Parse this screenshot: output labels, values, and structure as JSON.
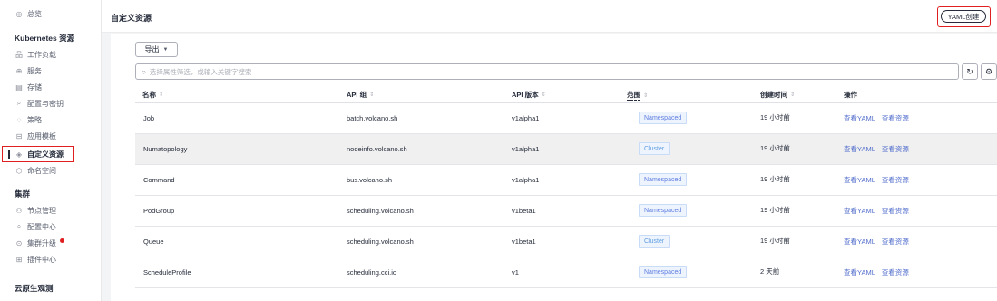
{
  "sidebar": {
    "overview": {
      "icon": "dashboard-icon",
      "label": "总览"
    },
    "section_k8s": "Kubernetes 资源",
    "k8s_items": [
      {
        "label": "工作负载",
        "icon": "workload-icon"
      },
      {
        "label": "服务",
        "icon": "service-icon"
      },
      {
        "label": "存储",
        "icon": "storage-icon"
      },
      {
        "label": "配置与密钥",
        "icon": "config-icon"
      },
      {
        "label": "策略",
        "icon": "policy-icon"
      },
      {
        "label": "应用模板",
        "icon": "template-icon"
      },
      {
        "label": "自定义资源",
        "icon": "crd-icon"
      },
      {
        "label": "命名空间",
        "icon": "namespace-icon"
      }
    ],
    "section_cluster": "集群",
    "cluster_items": [
      {
        "label": "节点管理",
        "icon": "node-icon"
      },
      {
        "label": "配置中心",
        "icon": "settings-icon"
      },
      {
        "label": "集群升级",
        "icon": "upgrade-icon"
      },
      {
        "label": "插件中心",
        "icon": "plugin-icon"
      }
    ],
    "section_observe": "云原生观测"
  },
  "header": {
    "title": "自定义资源",
    "yaml_create": "YAML创建"
  },
  "toolbar": {
    "export": "导出",
    "search_placeholder": "选择属性筛选，或输入关键字搜索"
  },
  "table": {
    "headers": [
      "名称",
      "API 组",
      "API 版本",
      "范围",
      "创建时间",
      "操作"
    ],
    "rows": [
      {
        "name": "Job",
        "group": "batch.volcano.sh",
        "version": "v1alpha1",
        "scope": "Namespaced",
        "created": "19 小时前"
      },
      {
        "name": "Numatopology",
        "group": "nodeinfo.volcano.sh",
        "version": "v1alpha1",
        "scope": "Cluster",
        "created": "19 小时前"
      },
      {
        "name": "Command",
        "group": "bus.volcano.sh",
        "version": "v1alpha1",
        "scope": "Namespaced",
        "created": "19 小时前"
      },
      {
        "name": "PodGroup",
        "group": "scheduling.volcano.sh",
        "version": "v1beta1",
        "scope": "Namespaced",
        "created": "19 小时前"
      },
      {
        "name": "Queue",
        "group": "scheduling.volcano.sh",
        "version": "v1beta1",
        "scope": "Cluster",
        "created": "19 小时前"
      },
      {
        "name": "ScheduleProfile",
        "group": "scheduling.cci.io",
        "version": "v1",
        "scope": "Namespaced",
        "created": "2 天前"
      }
    ],
    "action_view_yaml": "查看YAML",
    "action_view_resource": "查看资源"
  },
  "colors": {
    "accent": "#526ecc",
    "highlight_box": "#e02020",
    "tag_bg": "#edf4fe"
  }
}
